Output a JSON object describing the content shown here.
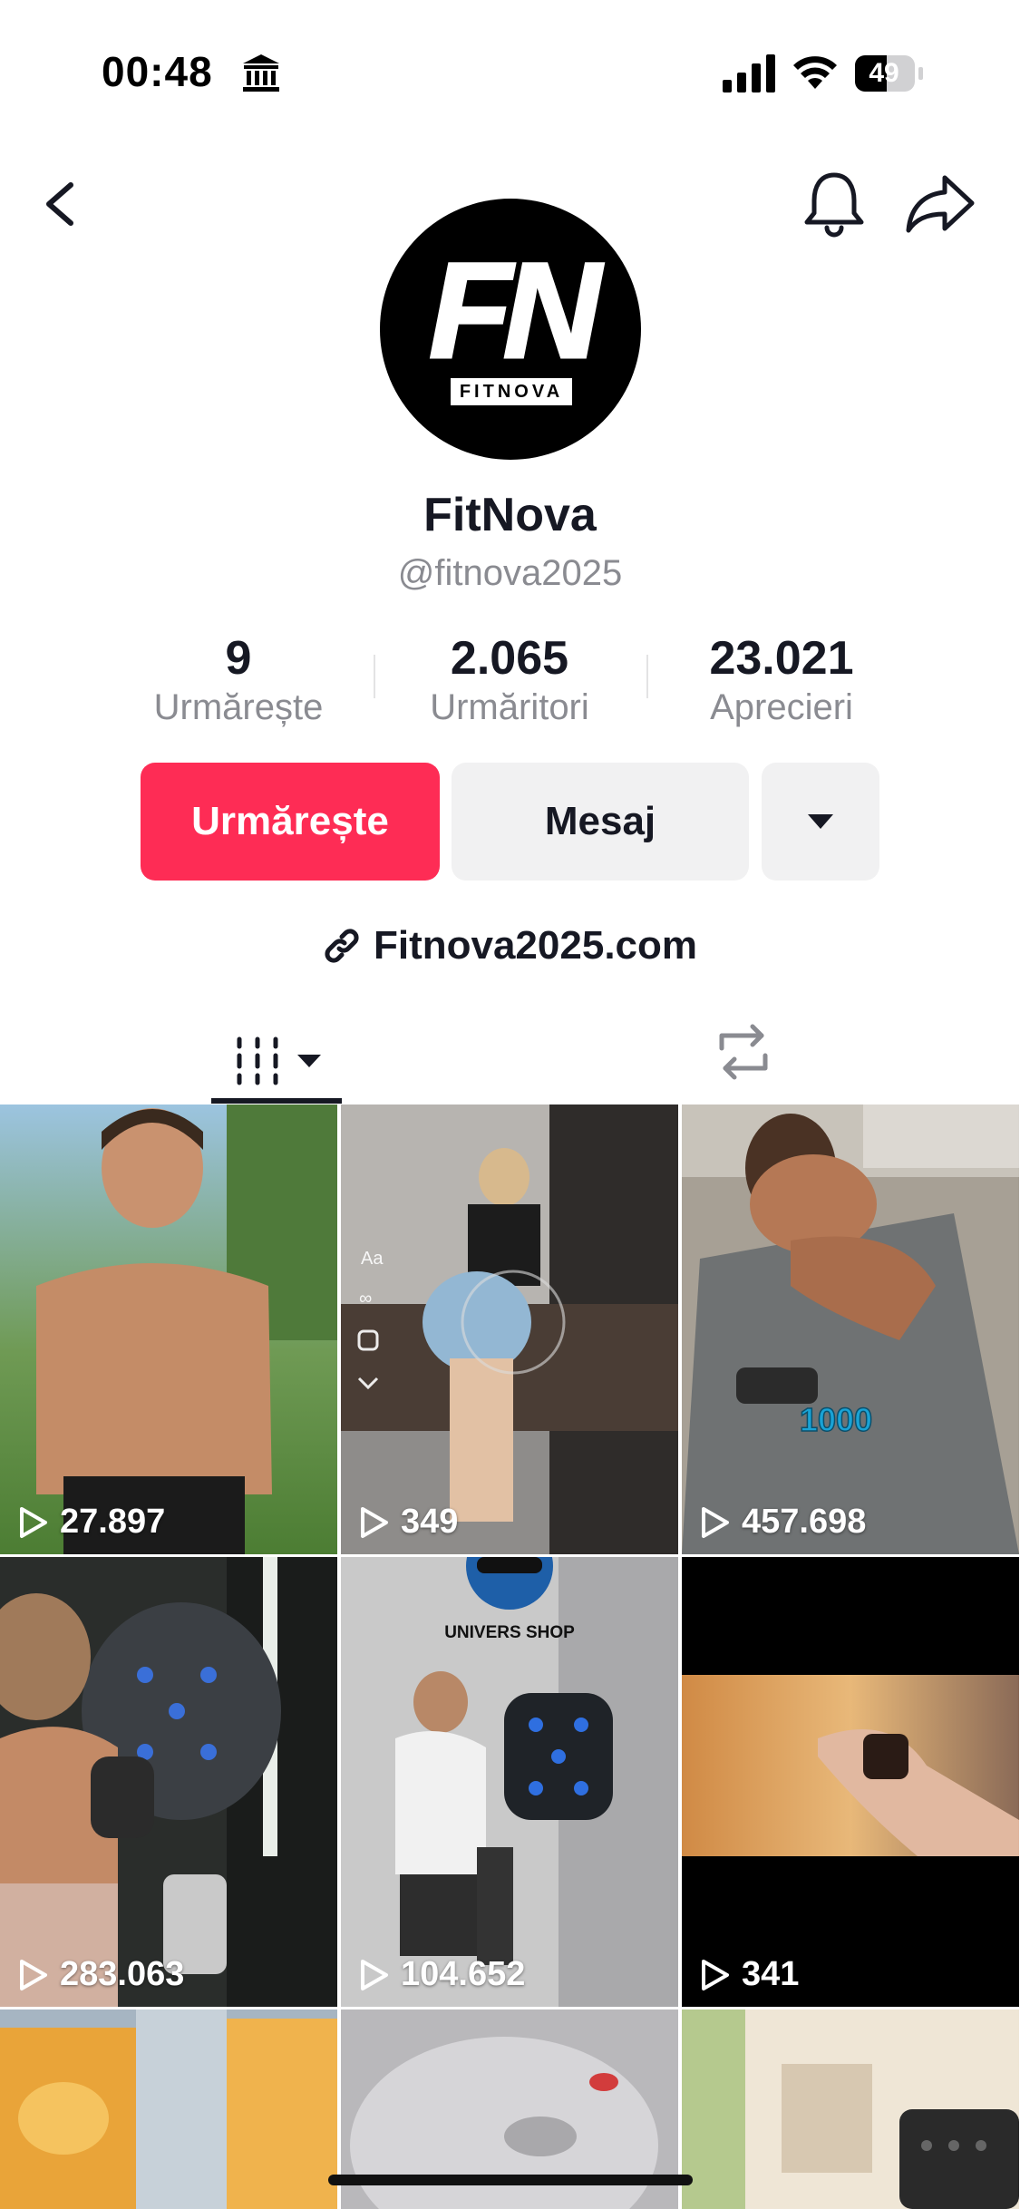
{
  "status_bar": {
    "time": "00:48",
    "battery_level": "49",
    "icons": [
      "bank-icon",
      "signal-icon",
      "wifi-icon",
      "battery-icon"
    ]
  },
  "header": {
    "icons": [
      "back-icon",
      "bell-icon",
      "share-icon"
    ]
  },
  "profile": {
    "avatar_logo": "FN",
    "avatar_logo_subtext": "FITNOVA",
    "display_name": "FitNova",
    "username": "@fitnova2025"
  },
  "stats": [
    {
      "value": "9",
      "label": "Urmărește"
    },
    {
      "value": "2.065",
      "label": "Urmăritori"
    },
    {
      "value": "23.021",
      "label": "Aprecieri"
    }
  ],
  "actions": {
    "follow_label": "Urmărește",
    "message_label": "Mesaj",
    "more_icon": "triangle-down-icon"
  },
  "website": {
    "icon": "link-icon",
    "text": "Fitnova2025.com"
  },
  "tabs": {
    "videos_icon": "grid-icon",
    "reposts_icon": "repost-icon"
  },
  "colors": {
    "accent": "#fe2c55",
    "secondary_button": "#f1f1f2",
    "muted_text": "#8a8b91"
  },
  "videos": [
    {
      "views": "27.897"
    },
    {
      "views": "349"
    },
    {
      "views": "457.698",
      "overlay_text": "1000"
    },
    {
      "views": "283.063"
    },
    {
      "views": "104.652",
      "overlay_text": "UNIVERS SHOP"
    },
    {
      "views": "341"
    },
    {
      "views": ""
    },
    {
      "views": ""
    },
    {
      "views": ""
    }
  ]
}
